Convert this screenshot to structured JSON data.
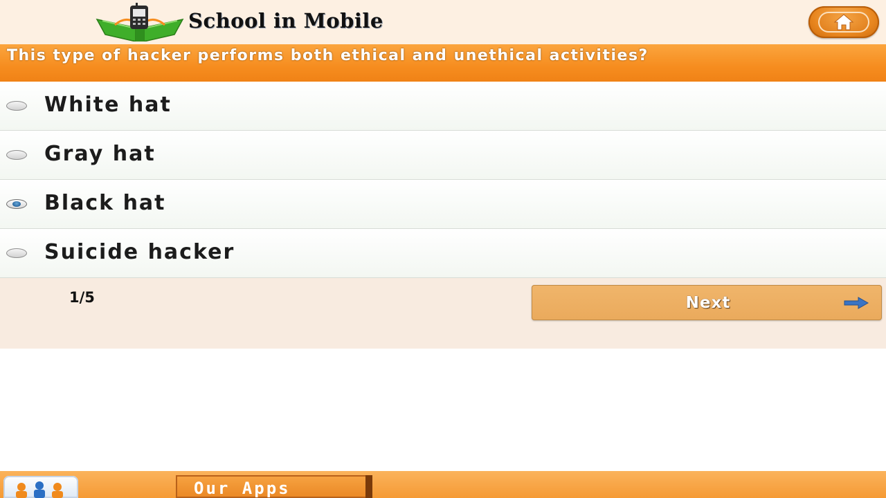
{
  "header": {
    "brand_title": "School in Mobile",
    "home_icon": "home-icon"
  },
  "question": {
    "text": "This type of hacker performs both ethical and unethical activities?"
  },
  "options": [
    {
      "label": "White hat",
      "selected": false
    },
    {
      "label": "Gray hat",
      "selected": false
    },
    {
      "label": "Black hat",
      "selected": true
    },
    {
      "label": "Suicide hacker",
      "selected": false
    }
  ],
  "footer": {
    "progress": "1/5",
    "next_label": "Next",
    "next_icon": "arrow-right-icon"
  },
  "bottom_bar": {
    "our_apps_label": "Our Apps",
    "apps_logo_icon": "app-logo-icon"
  },
  "colors": {
    "accent_orange": "#f68d1f",
    "header_bg": "#fdf0e2",
    "footer_bg": "#f8ebe0",
    "next_button": "#eaaa5c",
    "radio_selected": "#1f5e98"
  }
}
